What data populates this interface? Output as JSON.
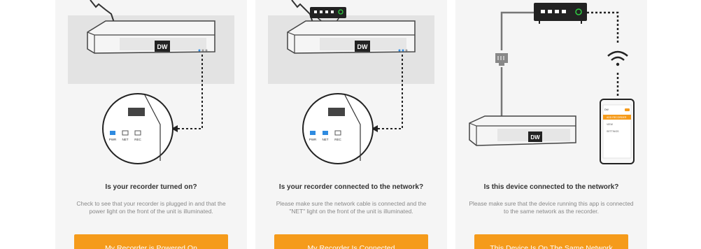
{
  "colors": {
    "accent": "#f59b1b",
    "power_light": "#2f8be0",
    "router_led": "#2ecc40"
  },
  "cards": [
    {
      "title": "Is your recorder turned on?",
      "description": "Check to see that your recorder is plugged in and that the power light on the front of the unit is illuminated.",
      "button": "My Recorder is Powered On",
      "leds": [
        "PWR",
        "NET",
        "REC"
      ],
      "logo": "DW"
    },
    {
      "title": "Is your recorder connected to the network?",
      "description": "Please make sure the network cable is connected and the \"NET\" light on the front of the unit is illuminated.",
      "button": "My Recorder Is Connected",
      "leds": [
        "PWR",
        "NET",
        "REC"
      ],
      "logo": "DW"
    },
    {
      "title": "Is this device connected to the network?",
      "description": "Please make sure that the device running this app is connected to the same network as the recorder.",
      "button": "This Device Is On The Same Network",
      "logo": "DW",
      "phone_items": [
        "DW",
        "ADD RECORDER",
        "VIEW",
        "SETTINGS"
      ]
    }
  ]
}
